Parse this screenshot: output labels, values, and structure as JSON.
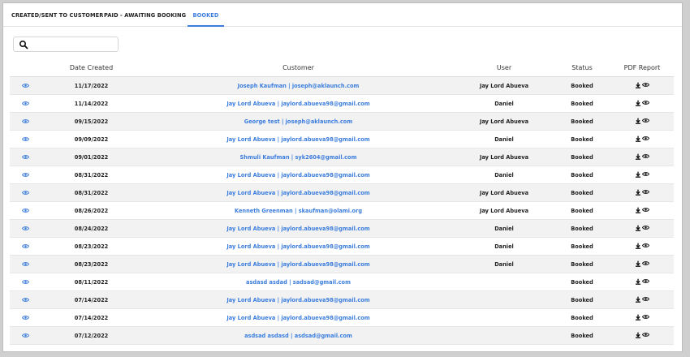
{
  "tabs": [
    {
      "label": "CREATED/SENT TO CUSTOMER",
      "active": false
    },
    {
      "label": "PAID - AWAITING BOOKING",
      "active": false
    },
    {
      "label": "BOOKED",
      "active": true
    }
  ],
  "search": {
    "placeholder": "",
    "value": ""
  },
  "table": {
    "headers": [
      "",
      "Date Created",
      "Customer",
      "User",
      "Status",
      "PDF Report"
    ],
    "rows": [
      {
        "date": "11/17/2022",
        "customer": "Joseph Kaufman | joseph@aklaunch.com",
        "user": "Jay Lord Abueva",
        "status": "Booked"
      },
      {
        "date": "11/14/2022",
        "customer": "Jay Lord Abueva | jaylord.abueva98@gmail.com",
        "user": "Daniel",
        "status": "Booked"
      },
      {
        "date": "09/15/2022",
        "customer": "George test | joseph@aklaunch.com",
        "user": "Jay Lord Abueva",
        "status": "Booked"
      },
      {
        "date": "09/09/2022",
        "customer": "Jay Lord Abueva | jaylord.abueva98@gmail.com",
        "user": "Daniel",
        "status": "Booked"
      },
      {
        "date": "09/01/2022",
        "customer": "Shmuli Kaufman | syk2604@gmail.com",
        "user": "Jay Lord Abueva",
        "status": "Booked"
      },
      {
        "date": "08/31/2022",
        "customer": "Jay Lord Abueva | jaylord.abueva98@gmail.com",
        "user": "Daniel",
        "status": "Booked"
      },
      {
        "date": "08/31/2022",
        "customer": "Jay Lord Abueva | jaylord.abueva98@gmail.com",
        "user": "Jay Lord Abueva",
        "status": "Booked"
      },
      {
        "date": "08/26/2022",
        "customer": "Kenneth Greenman | skaufman@olami.org",
        "user": "Jay Lord Abueva",
        "status": "Booked"
      },
      {
        "date": "08/24/2022",
        "customer": "Jay Lord Abueva | jaylord.abueva98@gmail.com",
        "user": "Daniel",
        "status": "Booked"
      },
      {
        "date": "08/23/2022",
        "customer": "Jay Lord Abueva | jaylord.abueva98@gmail.com",
        "user": "Daniel",
        "status": "Booked"
      },
      {
        "date": "08/23/2022",
        "customer": "Jay Lord Abueva | jaylord.abueva98@gmail.com",
        "user": "Daniel",
        "status": "Booked"
      },
      {
        "date": "08/11/2022",
        "customer": "asdasd asdad | sadsad@gmail.com",
        "user": "",
        "status": "Booked"
      },
      {
        "date": "07/14/2022",
        "customer": "Jay Lord Abueva | jaylord.abueva98@gmail.com",
        "user": "",
        "status": "Booked"
      },
      {
        "date": "07/14/2022",
        "customer": "Jay Lord Abueva | jaylord.abueva98@gmail.com",
        "user": "",
        "status": "Booked"
      },
      {
        "date": "07/12/2022",
        "customer": "asdsad asdasd | asdsad@gmail.com",
        "user": "",
        "status": "Booked"
      }
    ]
  },
  "icons": {
    "view": "eye-icon",
    "download": "download-icon",
    "preview": "eye-icon",
    "search": "search-icon"
  },
  "colors": {
    "accent": "#3b7ddd",
    "text": "#222222",
    "row_alt": "#f2f2f2"
  }
}
